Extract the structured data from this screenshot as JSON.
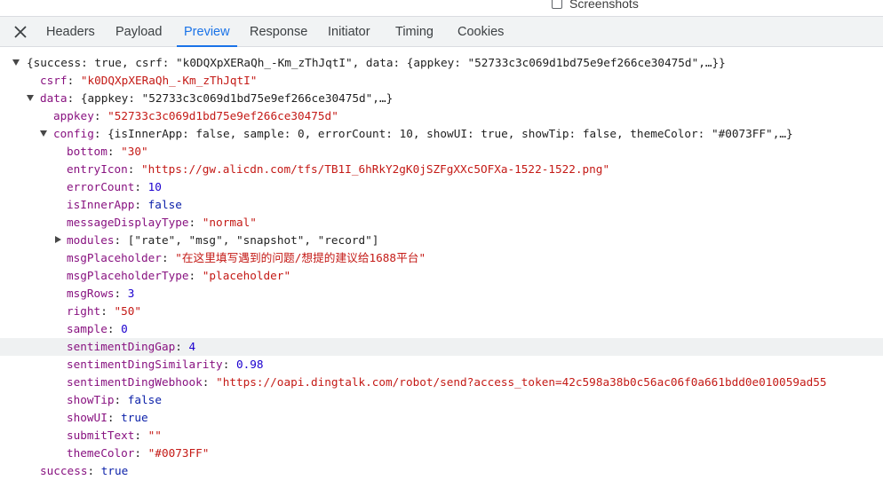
{
  "header": {
    "screenshots_label": "Screenshots"
  },
  "tabs": [
    {
      "label": "Headers"
    },
    {
      "label": "Payload"
    },
    {
      "label": "Preview",
      "active": true
    },
    {
      "label": "Response"
    },
    {
      "label": "Initiator"
    },
    {
      "label": "Timing"
    },
    {
      "label": "Cookies"
    }
  ],
  "tree": {
    "root_summary": "{success: true, csrf: \"k0DQXpXERaQh_-Km_zThJqtI\", data: {appkey: \"52733c3c069d1bd75e9ef266ce30475d\",…}}",
    "csrf_key": "csrf",
    "csrf_val": "\"k0DQXpXERaQh_-Km_zThJqtI\"",
    "data_key": "data",
    "data_summary": "{appkey: \"52733c3c069d1bd75e9ef266ce30475d\",…}",
    "appkey_key": "appkey",
    "appkey_val": "\"52733c3c069d1bd75e9ef266ce30475d\"",
    "config_key": "config",
    "config_summary": "{isInnerApp: false, sample: 0, errorCount: 10, showUI: true, showTip: false, themeColor: \"#0073FF\",…}",
    "config_items": [
      {
        "key": "bottom",
        "val": "\"30\""
      },
      {
        "key": "entryIcon",
        "val": "\"https://gw.alicdn.com/tfs/TB1I_6hRkY2gK0jSZFgXXc5OFXa-1522-1522.png\""
      },
      {
        "key": "errorCount",
        "val": "10"
      },
      {
        "key": "isInnerApp",
        "val": "false"
      },
      {
        "key": "messageDisplayType",
        "val": "\"normal\""
      },
      {
        "key": "modules",
        "val": "[\"rate\", \"msg\", \"snapshot\", \"record\"]"
      },
      {
        "key": "msgPlaceholder",
        "val": "\"在这里填写遇到的问题/想提的建议给1688平台\""
      },
      {
        "key": "msgPlaceholderType",
        "val": "\"placeholder\""
      },
      {
        "key": "msgRows",
        "val": "3"
      },
      {
        "key": "right",
        "val": "\"50\""
      },
      {
        "key": "sample",
        "val": "0"
      },
      {
        "key": "sentimentDingGap",
        "val": "4"
      },
      {
        "key": "sentimentDingSimilarity",
        "val": "0.98"
      },
      {
        "key": "sentimentDingWebhook",
        "val": "\"https://oapi.dingtalk.com/robot/send?access_token=42c598a38b0c56ac06f0a661bdd0e010059ad55"
      },
      {
        "key": "showTip",
        "val": "false"
      },
      {
        "key": "showUI",
        "val": "true"
      },
      {
        "key": "submitText",
        "val": "\"\""
      },
      {
        "key": "themeColor",
        "val": "\"#0073FF\""
      }
    ],
    "success_key": "success",
    "success_val": "true"
  }
}
